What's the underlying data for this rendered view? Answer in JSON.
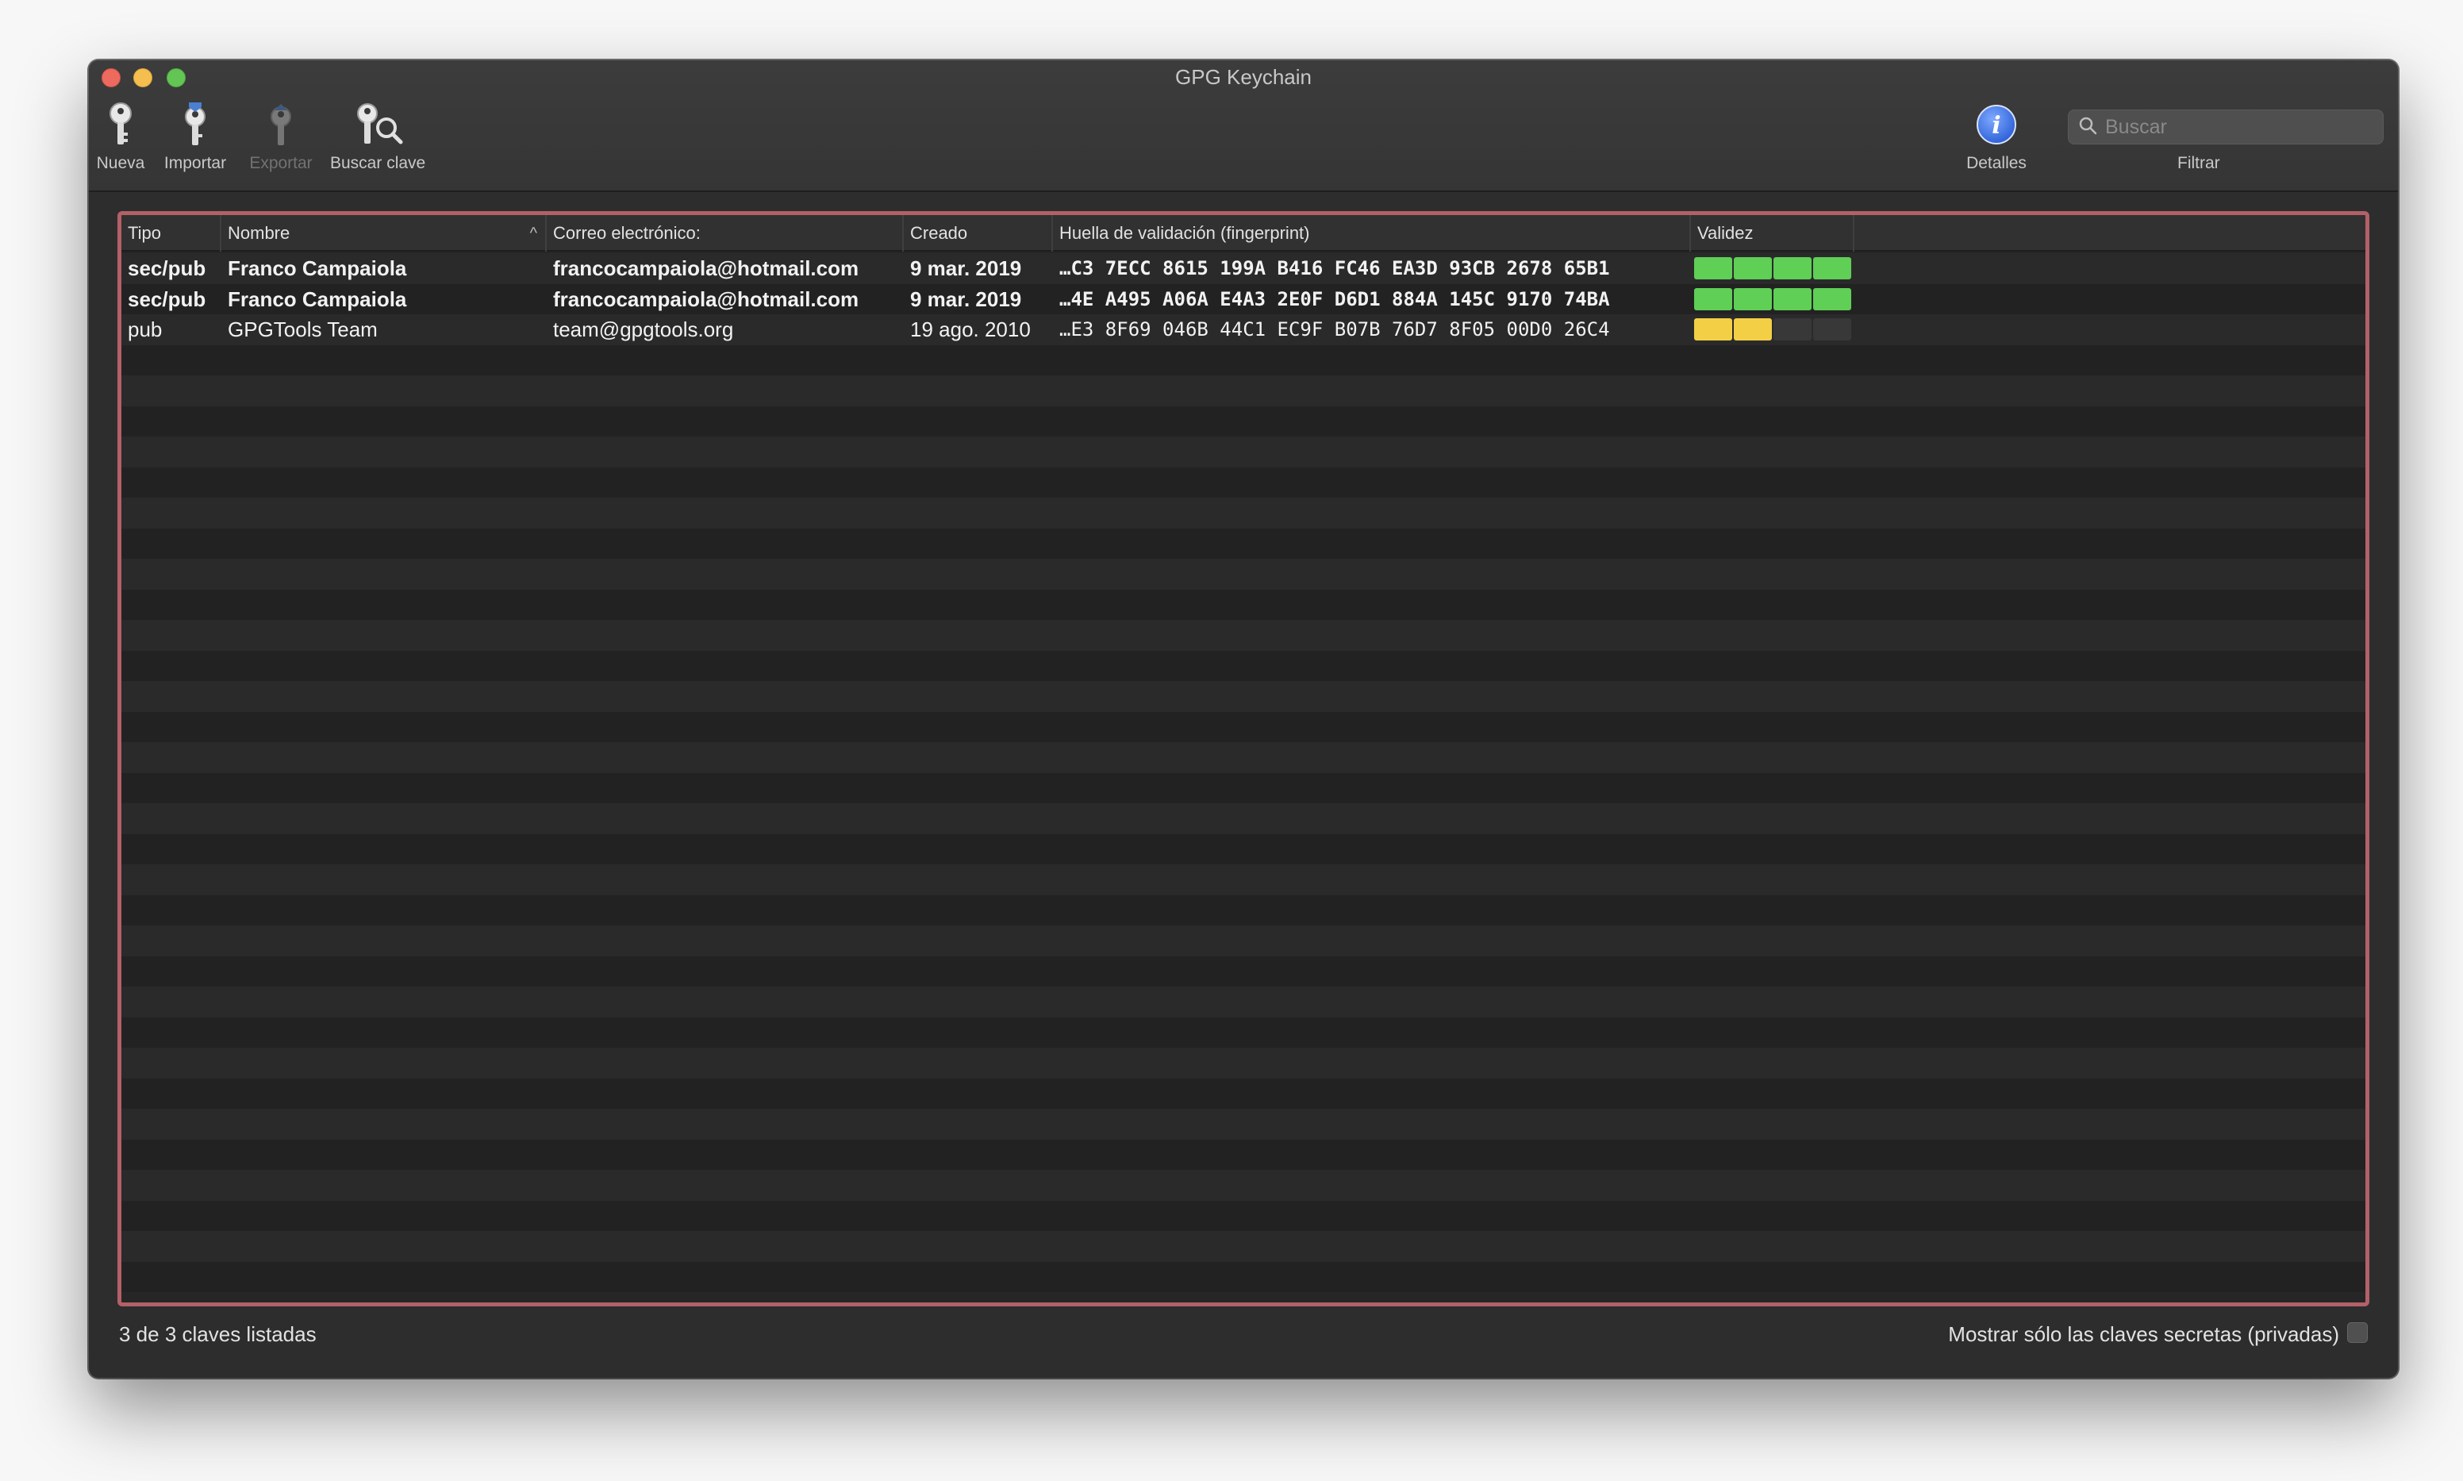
{
  "window": {
    "title": "GPG Keychain"
  },
  "toolbar": {
    "new_label": "Nueva",
    "import_label": "Importar",
    "export_label": "Exportar",
    "lookup_label": "Buscar clave",
    "details_label": "Detalles",
    "filter_label": "Filtrar",
    "search_placeholder": "Buscar"
  },
  "table": {
    "columns": {
      "type": "Tipo",
      "name": "Nombre",
      "email": "Correo electrónico:",
      "created": "Creado",
      "fingerprint": "Huella de validación (fingerprint)",
      "validity": "Validez"
    },
    "rows": [
      {
        "type": "sec/pub",
        "name": "Franco Campaiola",
        "email": "francocampaiola@hotmail.com",
        "created": "9 mar. 2019",
        "fingerprint": "…C3 7ECC 8615 199A B416  FC46 EA3D 93CB 2678 65B1",
        "validity": {
          "level": 4,
          "max": 4,
          "color": "#5fcf56"
        }
      },
      {
        "type": "sec/pub",
        "name": "Franco Campaiola",
        "email": "francocampaiola@hotmail.com",
        "created": "9 mar. 2019",
        "fingerprint": "…4E A495 A06A E4A3 2E0F  D6D1 884A 145C 9170 74BA",
        "validity": {
          "level": 4,
          "max": 4,
          "color": "#5fcf56"
        }
      },
      {
        "type": "pub",
        "name": "GPGTools Team",
        "email": "team@gpgtools.org",
        "created": "19 ago. 2010",
        "fingerprint": "…E3 8F69 046B 44C1 EC9F  B07B 76D7 8F05 00D0 26C4",
        "validity": {
          "level": 2,
          "max": 4,
          "color": "#f3cf46"
        }
      }
    ]
  },
  "status": {
    "count_text": "3 de 3 claves listadas",
    "secret_only_label": "Mostrar sólo las claves secretas (privadas)"
  }
}
